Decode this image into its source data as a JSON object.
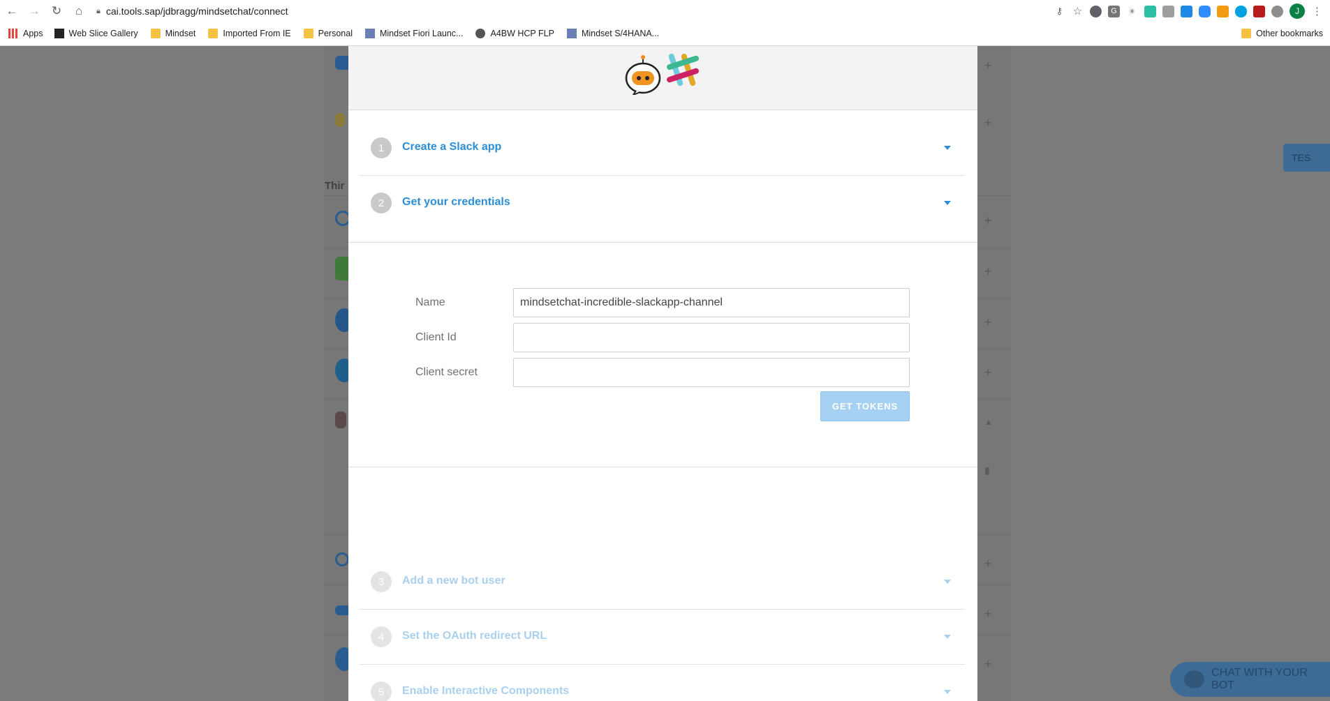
{
  "browser": {
    "url": "cai.tools.sap/jdbragg/mindsetchat/connect",
    "avatar_initial": "J",
    "bookmarks": [
      {
        "label": "Apps"
      },
      {
        "label": "Web Slice Gallery"
      },
      {
        "label": "Mindset"
      },
      {
        "label": "Imported From IE"
      },
      {
        "label": "Personal"
      },
      {
        "label": "Mindset Fiori Launc..."
      },
      {
        "label": "A4BW HCP FLP"
      },
      {
        "label": "Mindset S/4HANA..."
      }
    ],
    "other_bookmarks": "Other bookmarks"
  },
  "background": {
    "section_title": "Thir",
    "test_button": "TES",
    "chat_button": "CHAT WITH YOUR BOT"
  },
  "modal": {
    "steps_top": [
      {
        "num": "1",
        "label": "Create a Slack app"
      },
      {
        "num": "2",
        "label": "Get your credentials"
      }
    ],
    "form": {
      "name_label": "Name",
      "name_value": "mindsetchat-incredible-slackapp-channel",
      "client_id_label": "Client Id",
      "client_id_value": "",
      "client_secret_label": "Client secret",
      "client_secret_value": "",
      "get_tokens_label": "GET TOKENS"
    },
    "steps_bottom": [
      {
        "num": "3",
        "label": "Add a new bot user"
      },
      {
        "num": "4",
        "label": "Set the OAuth redirect URL"
      },
      {
        "num": "5",
        "label": "Enable Interactive Components"
      }
    ]
  }
}
